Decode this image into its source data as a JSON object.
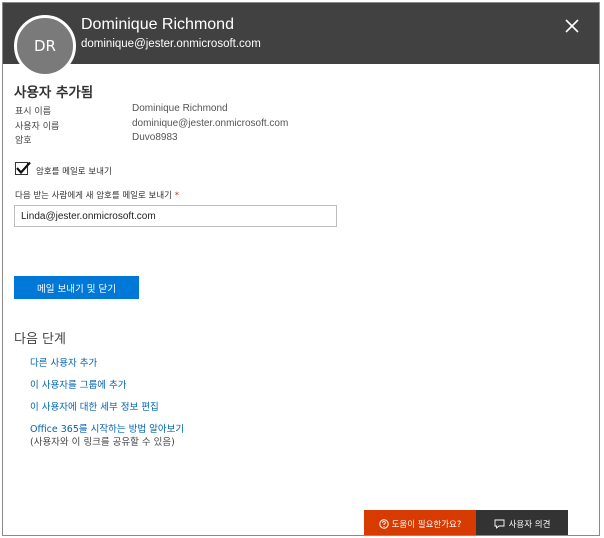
{
  "header": {
    "avatar_initials": "DR",
    "name": "Dominique Richmond",
    "email": "dominique@jester.onmicrosoft.com"
  },
  "user_added": {
    "title": "사용자 추가됨",
    "rows": [
      {
        "label": "표시 이름",
        "value": "Dominique Richmond"
      },
      {
        "label": "사용자 이름",
        "value": "dominique@jester.onmicrosoft.com"
      },
      {
        "label": "암호",
        "value": "Duvo8983"
      }
    ]
  },
  "email_option": {
    "checked": true,
    "checkbox_label": "암호를 메일로 보내기",
    "field_label": "다음 받는 사람에게 새 암호를 메일로 보내기",
    "required_mark": "*",
    "field_value": "Linda@jester.onmicrosoft.com",
    "send_button": "메일 보내기 및 닫기"
  },
  "next_steps": {
    "title": "다음 단계",
    "links": [
      "다른 사용자 추가",
      "이 사용자를 그룹에 추가",
      "이 사용자에 대한 세부 정보 편집",
      "Office 365를 시작하는 방법 알아보기"
    ],
    "note": "(사용자와 이 링크를 공유할 수 있음)"
  },
  "footer": {
    "help_label": "도움이 필요한가요?",
    "feedback_label": "사용자 의견"
  },
  "colors": {
    "header_bg": "#414141",
    "accent": "#0078d7",
    "link": "#0063b1",
    "help_bg": "#d83b01"
  }
}
